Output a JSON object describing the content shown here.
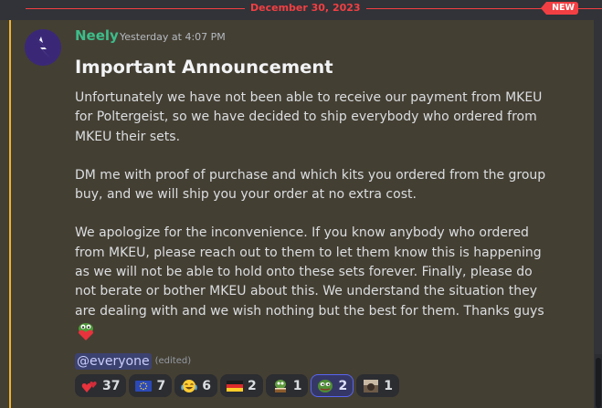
{
  "divider": {
    "date": "December 30, 2023",
    "badge": "NEW"
  },
  "message": {
    "author": "Neely",
    "timestamp": "Yesterday at 4:07 PM",
    "heading": "Important Announcement",
    "paragraphs": [
      "Unfortunately we have not been able to receive our payment from MKEU for Poltergeist, so we have decided to ship everybody who ordered from MKEU their sets.",
      "DM me with proof of purchase and which kits you ordered from the group buy, and we will ship you your order at no extra cost.",
      "We apologize for the inconvenience. If you know anybody who ordered from MKEU, please reach out to them to let them know this is happening as we will not be able to hold onto these sets forever. Finally, please do not berate or bother MKEU about this. We understand the situation they are dealing with and we wish nothing but the best for them. Thanks guys"
    ],
    "mention": "@everyone",
    "edited": "(edited)"
  },
  "reactions": [
    {
      "emoji": "hearts-emoji",
      "count": "37"
    },
    {
      "emoji": "eu-flag-emoji",
      "count": "7"
    },
    {
      "emoji": "joy-emoji",
      "count": "6"
    },
    {
      "emoji": "germany-flag-emoji",
      "count": "2"
    },
    {
      "emoji": "pepe-cake-emoji",
      "count": "1"
    },
    {
      "emoji": "pepe-emoji",
      "count": "2"
    },
    {
      "emoji": "meme-emoji",
      "count": "1"
    }
  ],
  "colors": {
    "background": "#313338",
    "highlight": "#443f33",
    "accent_red": "#f23f43",
    "username": "#3dbd8a",
    "mention_bar": "#f0b232"
  }
}
